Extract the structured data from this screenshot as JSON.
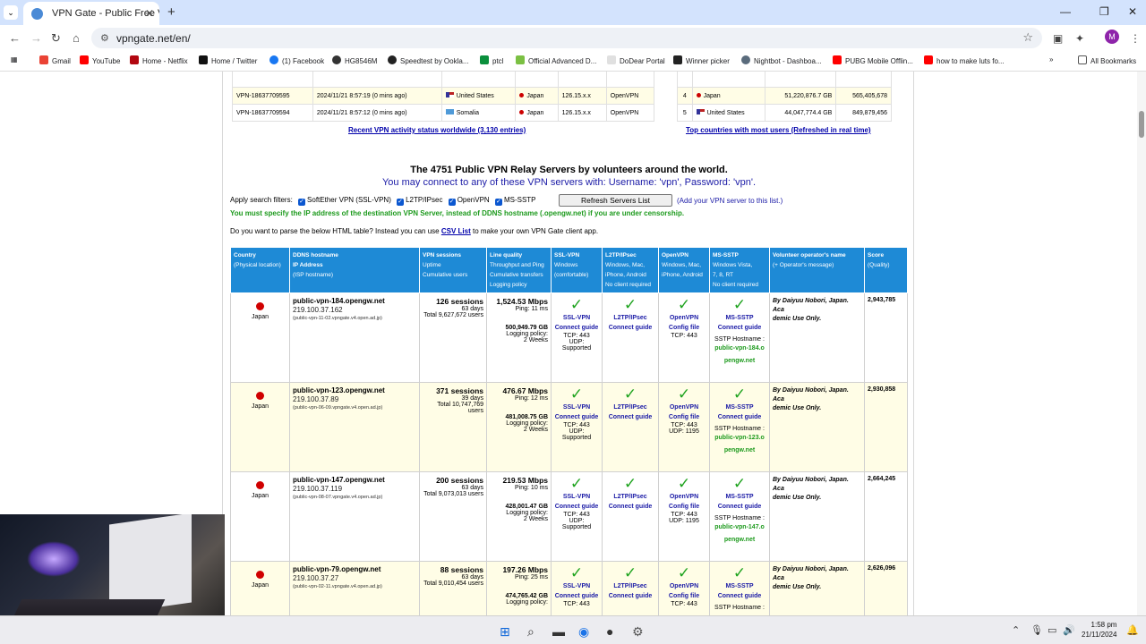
{
  "browser": {
    "tab_title": "VPN Gate - Public Free VPN Clo",
    "url": "vpngate.net/en/",
    "avatar_letter": "M",
    "bookmarks": [
      "Gmail",
      "YouTube",
      "Home - Netflix",
      "Home / Twitter",
      "(1) Facebook",
      "HG8546M",
      "Speedtest by Ookla...",
      "ptcl",
      "Official Advanced D...",
      "DoDear Portal",
      "Winner picker",
      "Nightbot - Dashboa...",
      "PUBG Mobile Offlin...",
      "how to make luts fo..."
    ],
    "all_bookmarks": "All Bookmarks"
  },
  "activity": {
    "rows": [
      {
        "id": "VPN-18637709595",
        "time": "2024/11/21 8:57:19 (0 mins ago)",
        "from": "United States",
        "to": "Japan",
        "ip": "126.15.x.x",
        "proto": "OpenVPN"
      },
      {
        "id": "VPN-18637709594",
        "time": "2024/11/21 8:57:12 (0 mins ago)",
        "from": "Somalia",
        "to": "Japan",
        "ip": "126.15.x.x",
        "proto": "OpenVPN"
      }
    ],
    "link": "Recent VPN activity status worldwide (3,130 entries)"
  },
  "countries": {
    "rows": [
      {
        "rank": "4",
        "country": "Japan",
        "gb": "51,220,876.7 GB",
        "count": "565,405,678"
      },
      {
        "rank": "5",
        "country": "United States",
        "gb": "44,047,774.4 GB",
        "count": "849,879,456"
      }
    ],
    "link": "Top countries with most users (Refreshed in real time)"
  },
  "heading": "The 4751 Public VPN Relay Servers by volunteers around the world.",
  "subheading": "You may connect to any of these VPN servers with: Username: 'vpn', Password: 'vpn'.",
  "filters": {
    "label": "Apply search filters:",
    "options": [
      "SoftEther VPN (SSL-VPN)",
      "L2TP/IPsec",
      "OpenVPN",
      "MS-SSTP"
    ],
    "refresh": "Refresh Servers List",
    "add": "(Add your VPN server to this list.)"
  },
  "warning": "You must specify the IP address of the destination VPN Server, instead of DDNS hostname (.opengw.net) if you are under censorship.",
  "csv": {
    "pre": "Do you want to parse the below HTML table? Instead you can use ",
    "link": "CSV List",
    "post": " to make your own VPN Gate client app."
  },
  "headers": [
    {
      "t": "Country",
      "s": "(Physical location)"
    },
    {
      "t": "DDNS hostname",
      "s": "IP Address",
      "s2": "(ISP hostname)"
    },
    {
      "t": "VPN sessions",
      "s": "Uptime",
      "s2": "Cumulative users"
    },
    {
      "t": "Line quality",
      "s": "Throughput and Ping",
      "s2": "Cumulative transfers",
      "s3": "Logging policy"
    },
    {
      "t": "SSL-VPN",
      "s": "Windows",
      "s2": "(comfortable)"
    },
    {
      "t": "L2TP/IPsec",
      "s": "Windows, Mac,",
      "s2": "iPhone, Android",
      "s3": "No client required"
    },
    {
      "t": "OpenVPN",
      "s": "Windows, Mac,",
      "s2": "iPhone, Android"
    },
    {
      "t": "MS-SSTP",
      "s": "Windows Vista,",
      "s2": "7, 8, RT",
      "s3": "No client required"
    },
    {
      "t": "Volunteer operator's name",
      "s": "(+ Operator's message)"
    },
    {
      "t": "Score",
      "s": "(Quality)"
    }
  ],
  "servers": [
    {
      "country": "Japan",
      "host": "public-vpn-184.opengw.net",
      "ip": "219.100.37.162",
      "isp": "(public-vpn-11-02.vpngate.v4.open.ad.jp)",
      "sessions": "126 sessions",
      "uptime": "63 days",
      "total": "Total 9,627,672 users",
      "mbps": "1,524.53 Mbps",
      "ping": "Ping: 11 ms",
      "gb": "500,949.79 GB",
      "log1": "Logging policy:",
      "log2": "2 Weeks",
      "ssl_tcp": "TCP: 443",
      "ssl_udp": "UDP: Supported",
      "ovpn_tcp": "TCP: 443",
      "ovpn_udp": "",
      "sstp_host": "public-vpn-184.o",
      "sstp_host2": "pengw.net",
      "op": "By Daiyuu Nobori, Japan. Aca",
      "op2": "demic Use Only.",
      "score": "2,943,785"
    },
    {
      "country": "Japan",
      "host": "public-vpn-123.opengw.net",
      "ip": "219.100.37.89",
      "isp": "(public-vpn-06-09.vpngate.v4.open.ad.jp)",
      "sessions": "371 sessions",
      "uptime": "39 days",
      "total": "Total 10,747,769 users",
      "mbps": "476.67 Mbps",
      "ping": "Ping: 12 ms",
      "gb": "481,008.75 GB",
      "log1": "Logging policy:",
      "log2": "2 Weeks",
      "ssl_tcp": "TCP: 443",
      "ssl_udp": "UDP: Supported",
      "ovpn_tcp": "TCP: 443",
      "ovpn_udp": "UDP: 1195",
      "sstp_host": "public-vpn-123.o",
      "sstp_host2": "pengw.net",
      "op": "By Daiyuu Nobori, Japan. Aca",
      "op2": "demic Use Only.",
      "score": "2,930,858"
    },
    {
      "country": "Japan",
      "host": "public-vpn-147.opengw.net",
      "ip": "219.100.37.119",
      "isp": "(public-vpn-08-07.vpngate.v4.open.ad.jp)",
      "sessions": "200 sessions",
      "uptime": "63 days",
      "total": "Total 9,073,013 users",
      "mbps": "219.53 Mbps",
      "ping": "Ping: 10 ms",
      "gb": "428,001.47 GB",
      "log1": "Logging policy:",
      "log2": "2 Weeks",
      "ssl_tcp": "TCP: 443",
      "ssl_udp": "UDP: Supported",
      "ovpn_tcp": "TCP: 443",
      "ovpn_udp": "UDP: 1195",
      "sstp_host": "public-vpn-147.o",
      "sstp_host2": "pengw.net",
      "op": "By Daiyuu Nobori, Japan. Aca",
      "op2": "demic Use Only.",
      "score": "2,664,245"
    },
    {
      "country": "Japan",
      "host": "public-vpn-79.opengw.net",
      "ip": "219.100.37.27",
      "isp": "(public-vpn-02-11.vpngate.v4.open.ad.jp)",
      "sessions": "88 sessions",
      "uptime": "63 days",
      "total": "Total 9,010,454 users",
      "mbps": "197.26 Mbps",
      "ping": "Ping: 25 ms",
      "gb": "474,765.42 GB",
      "log1": "Logging policy:",
      "log2": "",
      "ssl_tcp": "TCP: 443",
      "ssl_udp": "",
      "ovpn_tcp": "TCP: 443",
      "ovpn_udp": "",
      "sstp_host": "",
      "sstp_host2": "",
      "op": "By Daiyuu Nobori, Japan. Aca",
      "op2": "demic Use Only.",
      "score": "2,626,096"
    }
  ],
  "labels": {
    "ssl": "SSL-VPN",
    "l2tp": "L2TP/IPsec",
    "ovpn": "OpenVPN",
    "sstp": "MS-SSTP",
    "connect": "Connect guide",
    "config": "Config file",
    "sstp_hostname": "SSTP Hostname :"
  },
  "clock": {
    "time": "1:58 pm",
    "date": "21/11/2024"
  }
}
